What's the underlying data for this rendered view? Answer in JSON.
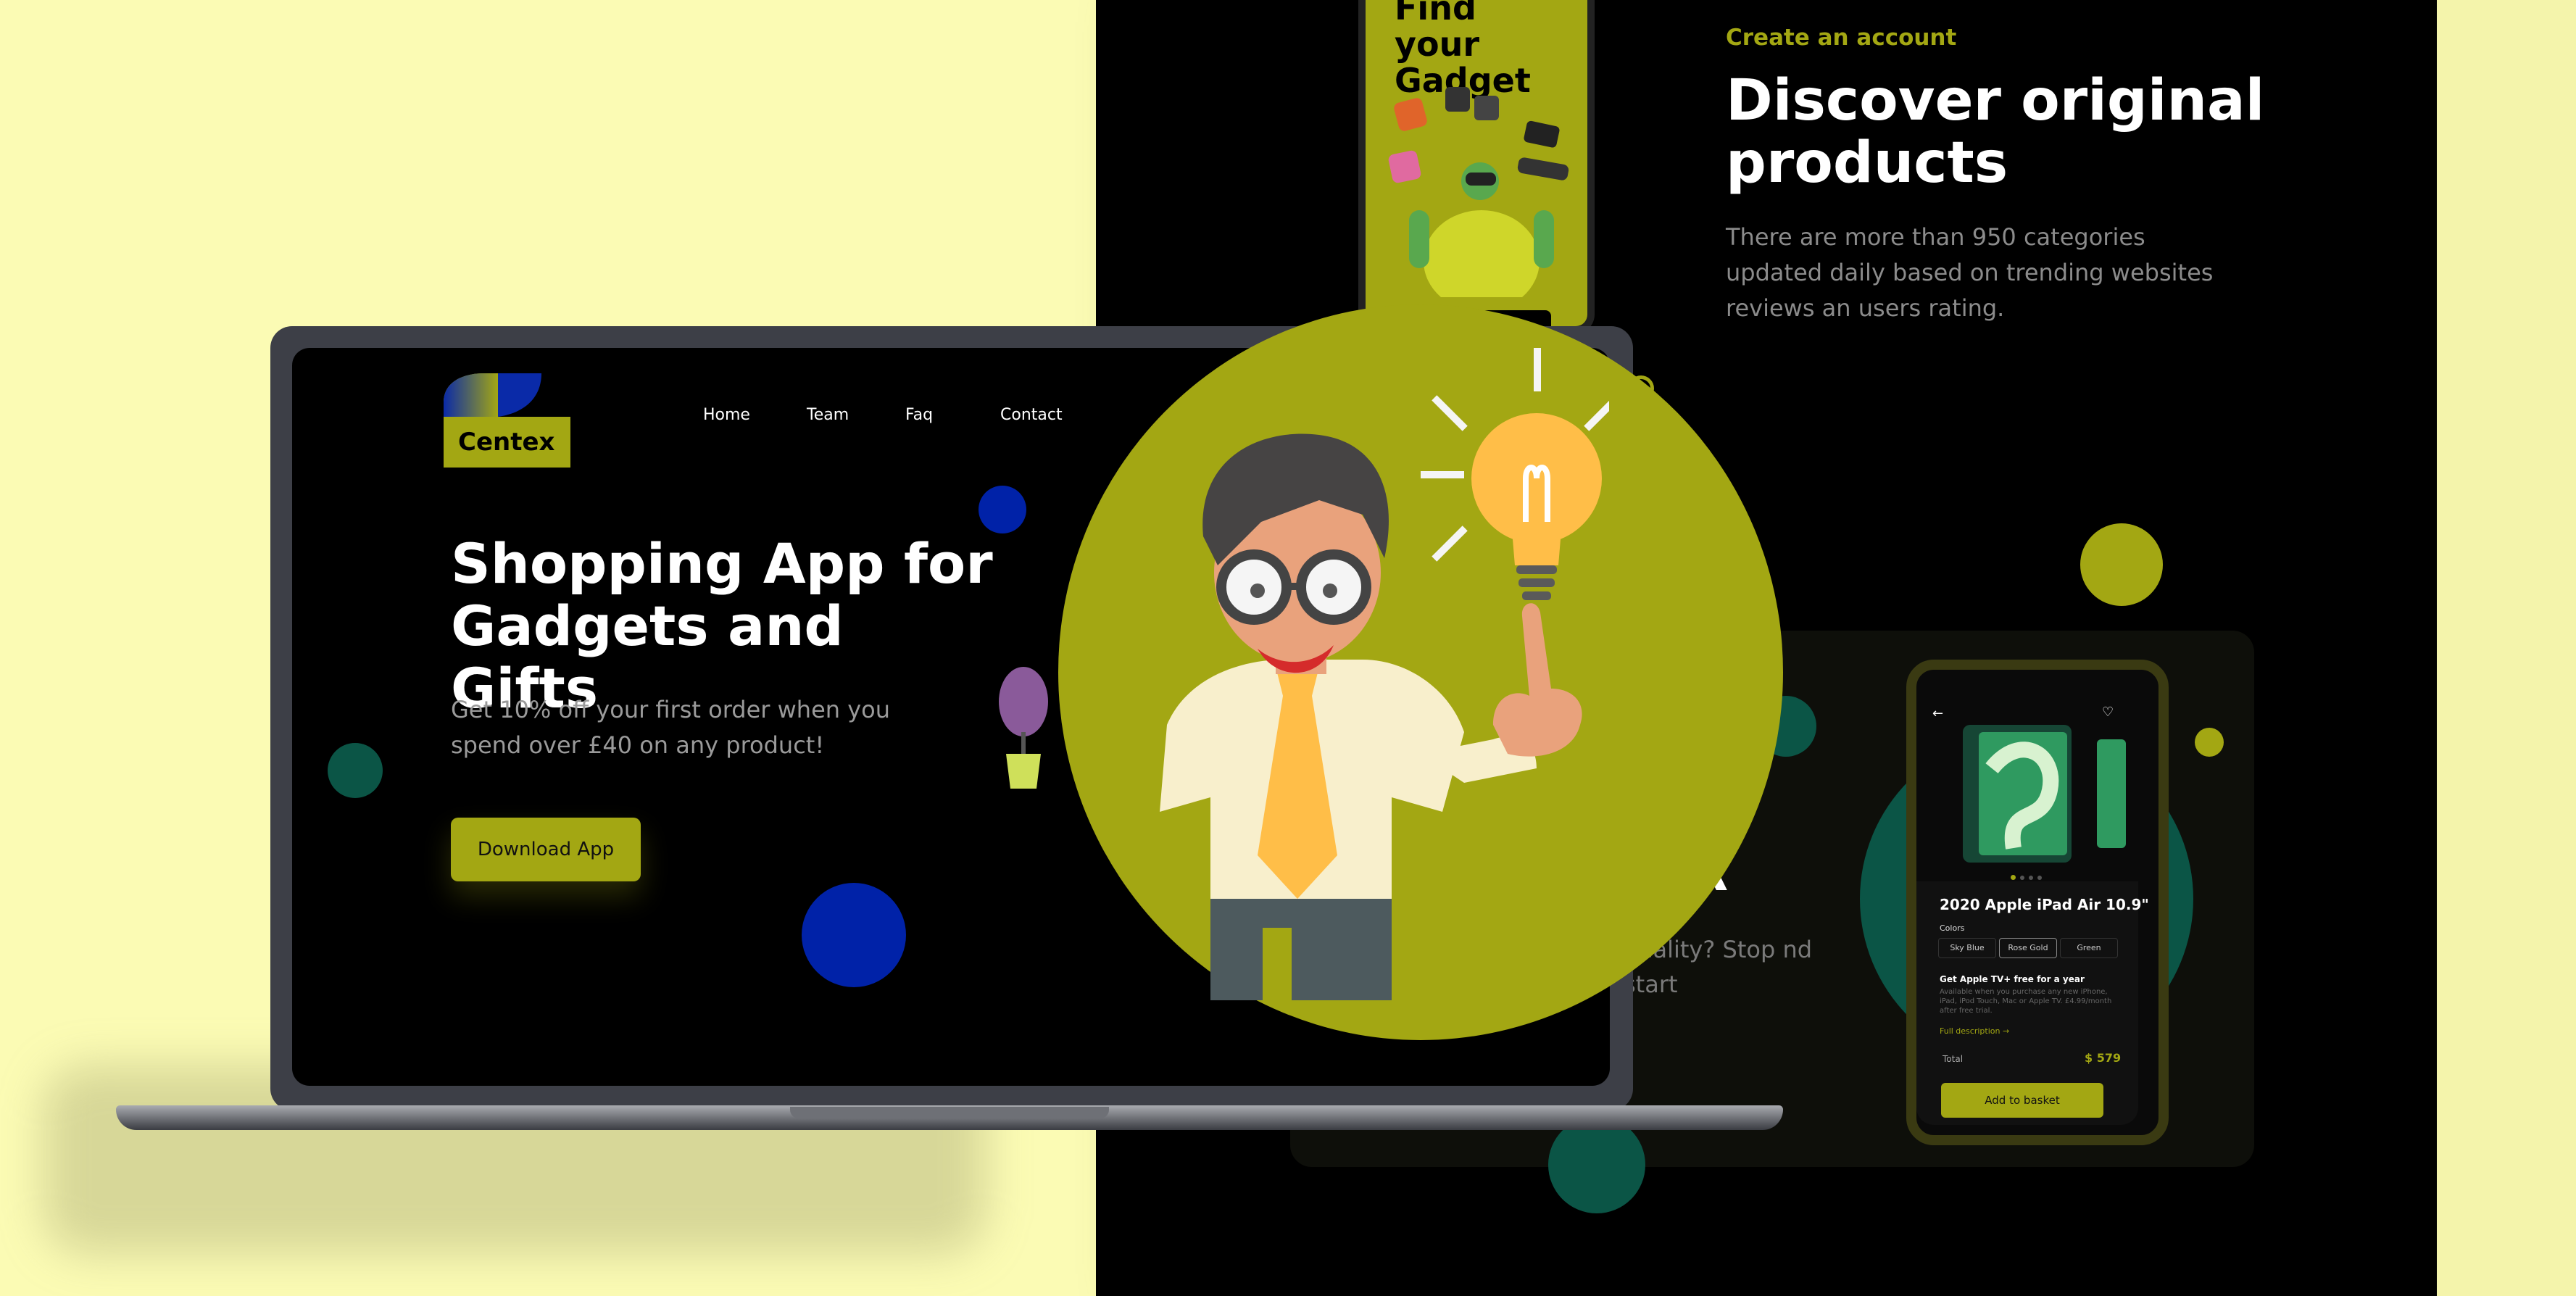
{
  "colors": {
    "accent": "#a3a713",
    "background": "#fbfbb4",
    "dark": "#000000",
    "blue": "#0022a8",
    "teal": "#0b5546"
  },
  "landing": {
    "logo_text": "Centex",
    "nav": [
      "Home",
      "Team",
      "Faq",
      "Contact"
    ],
    "active_nav": "Home",
    "hero_title": "Shopping App for Gadgets and Gifts",
    "hero_text": "Get 10% off your first order when you spend over £40 on any product!",
    "download_label": "Download App"
  },
  "right_page": {
    "create_account": "Create an account",
    "discover_title": "Discover original products",
    "discover_text": "There are more than 950 categories updated daily based on trending websites reviews an users rating.",
    "ar_title": "AR",
    "ar_text": "Reality? Stop nd start"
  },
  "find_phone": {
    "title": "Find your Gadget"
  },
  "product_phone": {
    "product_name": "2020 Apple iPad Air 10.9\"",
    "colors_label": "Colors",
    "color_options": [
      "Sky Blue",
      "Rose Gold",
      "Green"
    ],
    "promo_title": "Get Apple TV+ free for a year",
    "promo_text": "Available when you purchase any new iPhone, iPad, iPod Touch, Mac or Apple TV. £4.99/month after free trial.",
    "full_description": "Full description →",
    "total_label": "Total",
    "total_value": "$ 579",
    "add_to_basket": "Add to basket"
  }
}
